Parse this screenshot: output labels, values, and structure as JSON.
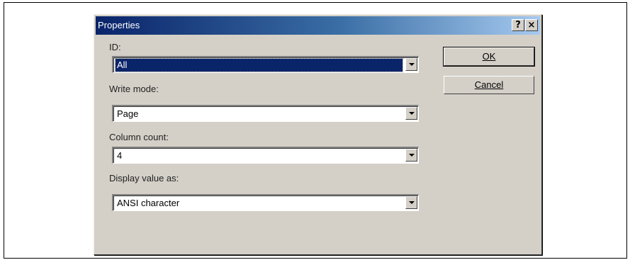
{
  "dialog": {
    "title": "Properties",
    "help_label": "?",
    "close_label": "×"
  },
  "fields": {
    "id": {
      "label": "ID:",
      "value": "All"
    },
    "write_mode": {
      "label": "Write mode:",
      "value": "Page"
    },
    "column_count": {
      "label": "Column count:",
      "value": "4"
    },
    "display_value": {
      "label": "Display value as:",
      "value": "ANSI character"
    }
  },
  "buttons": {
    "ok": "OK",
    "cancel": "Cancel"
  },
  "colors": {
    "titlebar_start": "#0a246a",
    "titlebar_end": "#a6caf0",
    "dialog_bg": "#d4d0c8",
    "selection_bg": "#0a246a"
  }
}
